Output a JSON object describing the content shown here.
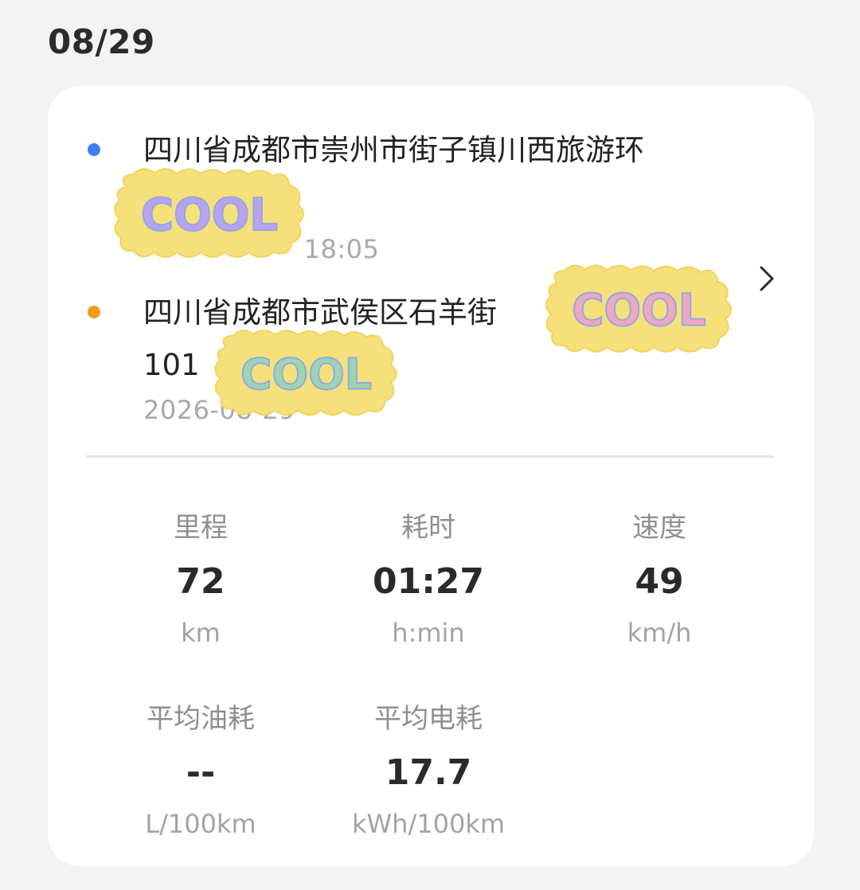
{
  "date": "08/29",
  "route": {
    "start": {
      "address": "四川省成都市崇州市街子镇川西旅游环",
      "time": "18:05",
      "dot_color": "#3d7ff0"
    },
    "end": {
      "address": "四川省成都市武侯区石羊街",
      "address_line2": "101",
      "time": "2026-08-29",
      "dot_color": "#f39a1d"
    }
  },
  "stats": {
    "distance": {
      "label": "里程",
      "value": "72",
      "unit": "km"
    },
    "duration": {
      "label": "耗时",
      "value": "01:27",
      "unit": "h:min"
    },
    "speed": {
      "label": "速度",
      "value": "49",
      "unit": "km/h"
    },
    "fuel": {
      "label": "平均油耗",
      "value": "--",
      "unit": "L/100km"
    },
    "energy": {
      "label": "平均电耗",
      "value": "17.7",
      "unit": "kWh/100km"
    }
  },
  "stickers": {
    "text": "COOL"
  },
  "icons": {
    "detail": "chevron-right-icon"
  }
}
